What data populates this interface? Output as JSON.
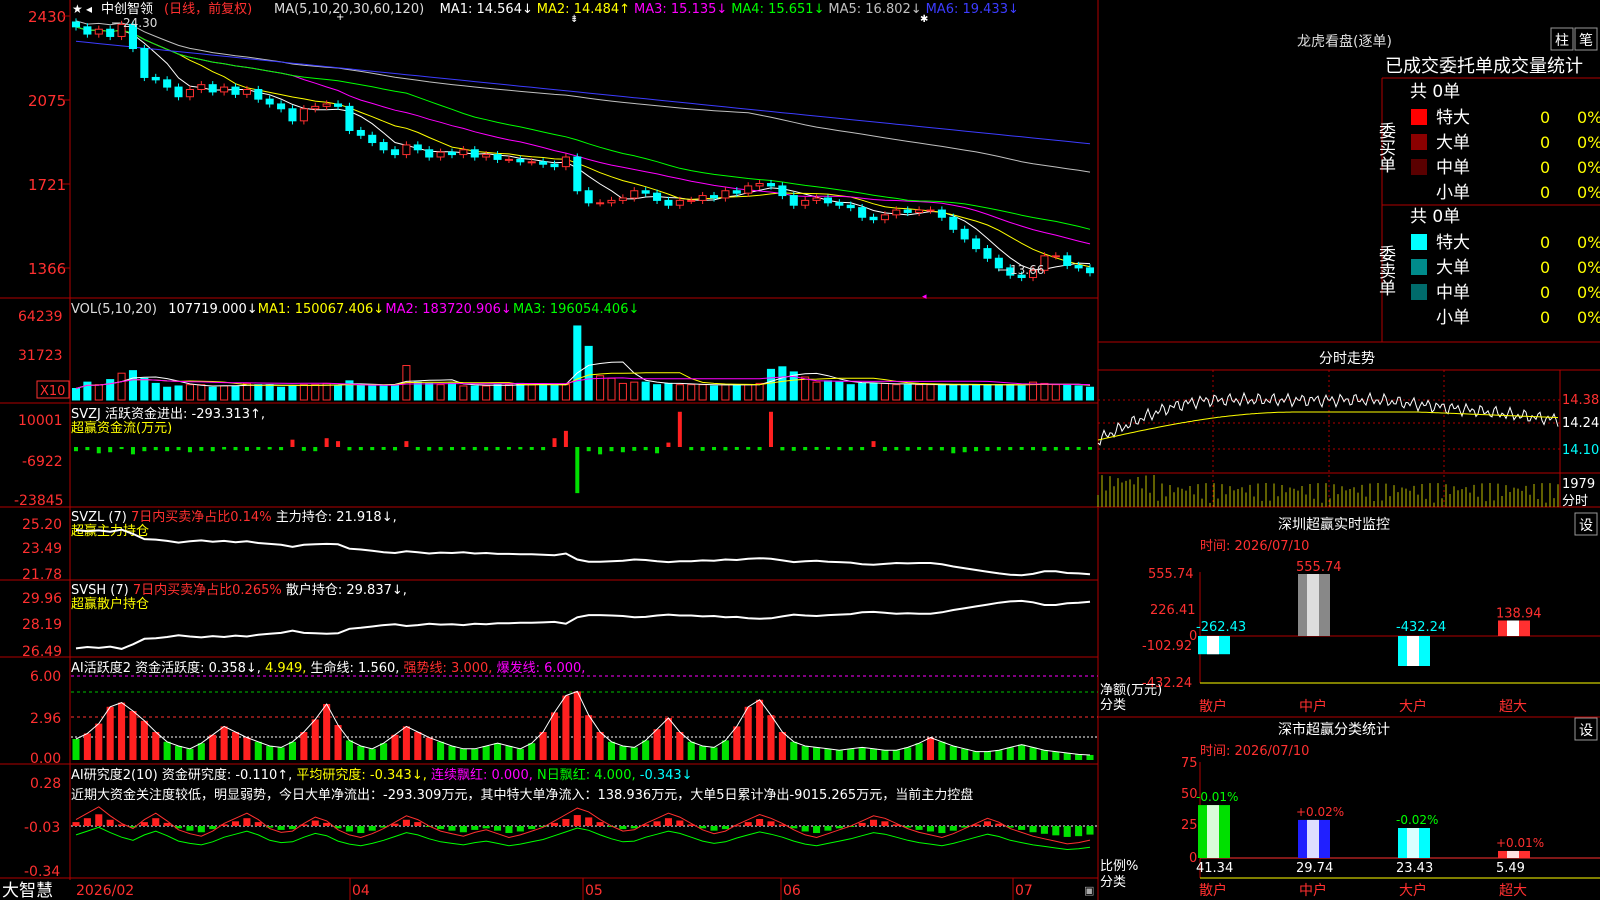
{
  "stock": {
    "name": "中创智领",
    "period": "(日线，前复权)",
    "high_label": "24.30",
    "low_label": "13.66"
  },
  "price_axis": {
    "ticks": [
      "2430",
      "2075",
      "1721",
      "1366"
    ]
  },
  "ma_legend": [
    {
      "label": "MA(5,10,20,30,60,120)",
      "color": "#dddddd"
    },
    {
      "label": "MA1: 14.564↓",
      "color": "#ffffff"
    },
    {
      "label": "MA2: 14.484↑",
      "color": "#ffff00"
    },
    {
      "label": "MA3: 15.135↓",
      "color": "#ff00ff"
    },
    {
      "label": "MA4: 15.651↓",
      "color": "#00ff00"
    },
    {
      "label": "MA5: 16.802↓",
      "color": "#c0c0c0"
    },
    {
      "label": "MA6: 19.433↓",
      "color": "#3c3cff"
    }
  ],
  "vol_legend": [
    {
      "label": "VOL(5,10,20)",
      "color": "#dddddd"
    },
    {
      "label": "107719.000↓",
      "color": "#ffffff"
    },
    {
      "label": "MA1: 150067.406↓",
      "color": "#ffff00"
    },
    {
      "label": "MA2: 183720.906↓",
      "color": "#ff00ff"
    },
    {
      "label": "MA3: 196054.406↓",
      "color": "#00ff00"
    }
  ],
  "vol_axis": {
    "ticks": [
      "64239",
      "31723"
    ],
    "unit": "X10"
  },
  "svzj": {
    "legend": "SVZJ  活跃资金进出: -293.313↑,",
    "sub": "超赢资金流(万元)",
    "ticks": [
      "10001",
      "-6922",
      "-23845"
    ]
  },
  "svzl": {
    "legend_a": "SVZL (7)",
    "legend_b": "7日内买卖净占比0.14%",
    "legend_c": "主力持仓: 21.918↓,",
    "sub": "超赢主力持仓",
    "ticks": [
      "25.20",
      "23.49",
      "21.78"
    ]
  },
  "svsh": {
    "legend_a": "SVSH (7)",
    "legend_b": "7日内买卖净占比0.265%",
    "legend_c": "散户持仓: 29.837↓,",
    "sub": "超赢散户持仓",
    "ticks": [
      "29.96",
      "28.19",
      "26.49"
    ]
  },
  "ai_active": {
    "legend_a": "AI活跃度2 资金活跃度: 0.358↓,",
    "legend_b": "4.949,",
    "legend_c": "生命线: 1.560,",
    "legend_d": "强势线: 3.000,",
    "legend_e": "爆发线: 6.000,",
    "ticks": [
      "6.00",
      "2.96",
      "0.00"
    ]
  },
  "ai_research": {
    "legend_a": "AI研究度2(10) 资金研究度: -0.110↑,",
    "legend_b": "平均研究度: -0.343↓,",
    "legend_c": "连续飘红: 0.000,",
    "legend_d": "N日飘红: 4.000,",
    "legend_e": "-0.343↓",
    "comment": "近期大资金关注度较低，明显弱势，今日大单净流出：-293.309万元，其中特大单净流入：138.936万元，大单5日累计净出-9015.265万元，当前主力控盘",
    "ticks": [
      "0.28",
      "-0.03",
      "-0.34"
    ]
  },
  "x_axis": {
    "brand": "大智慧",
    "labels": [
      "2026/02",
      "04",
      "05",
      "06",
      "07"
    ]
  },
  "lhb": {
    "title": "龙虎看盘(逐单)",
    "btn_zhu": "柱",
    "btn_bi": "笔",
    "subtitle": "已成交委托单成交量统计",
    "buy": {
      "side": "委买单",
      "total": "共 0单",
      "rows": [
        {
          "n": "特大",
          "v": "0",
          "p": "0%",
          "c": "#ff0000"
        },
        {
          "n": "大单",
          "v": "0",
          "p": "0%",
          "c": "#8b0000"
        },
        {
          "n": "中单",
          "v": "0",
          "p": "0%",
          "c": "#5a0000"
        },
        {
          "n": "小单",
          "v": "0",
          "p": "0%",
          "c": ""
        }
      ]
    },
    "sell": {
      "side": "委卖单",
      "total": "共 0单",
      "rows": [
        {
          "n": "特大",
          "v": "0",
          "p": "0%",
          "c": "#00ffff"
        },
        {
          "n": "大单",
          "v": "0",
          "p": "0%",
          "c": "#008b8b"
        },
        {
          "n": "中单",
          "v": "0",
          "p": "0%",
          "c": "#006b6b"
        },
        {
          "n": "小单",
          "v": "0",
          "p": "0%",
          "c": ""
        }
      ]
    }
  },
  "intraday": {
    "title": "分时走势",
    "ticks": [
      "14.38",
      "14.24",
      "14.10"
    ],
    "vol_label": "1979",
    "vol_unit": "分时"
  },
  "sz_monitor": {
    "title": "深圳超赢实时监控",
    "btn": "设",
    "time": "时间: 2026/07/10",
    "yticks": [
      "555.74",
      "226.41",
      "0",
      "-102.92",
      "-432.24"
    ],
    "ylabel": "净额(万元)",
    "xlabel": "分类",
    "cats": [
      "散户",
      "中户",
      "大户",
      "超大"
    ],
    "values": [
      -262.43,
      555.74,
      -432.24,
      138.94
    ],
    "labels": [
      "-262.43",
      "555.74",
      "-432.24",
      "138.94"
    ]
  },
  "sz_class": {
    "title": "深市超赢分类统计",
    "btn": "设",
    "time": "时间: 2026/07/10",
    "yticks": [
      "75",
      "50",
      "25",
      "0"
    ],
    "ylabel": "比例%",
    "xlabel": "分类",
    "cats": [
      "散户",
      "中户",
      "大户",
      "超大"
    ],
    "values": [
      41.34,
      29.74,
      23.43,
      5.49
    ],
    "labels": [
      "41.34",
      "29.74",
      "23.43",
      "5.49"
    ],
    "deltas": [
      "-0.01%",
      "+0.02%",
      "-0.02%",
      "+0.01%"
    ]
  },
  "chart_data": {
    "type": "line",
    "title": "中创智领 (日线，前复权)",
    "price_range": [
      13.2,
      24.4
    ],
    "close_series": [
      24.2,
      23.9,
      24.1,
      23.8,
      24.3,
      23.3,
      22.1,
      22.0,
      21.7,
      21.3,
      21.6,
      21.8,
      21.5,
      21.7,
      21.4,
      21.6,
      21.2,
      21.0,
      20.8,
      20.3,
      20.8,
      20.9,
      21.0,
      20.9,
      19.9,
      19.7,
      19.4,
      19.1,
      18.9,
      19.3,
      19.1,
      18.8,
      19.0,
      18.9,
      19.1,
      18.8,
      18.9,
      18.7,
      18.7,
      18.6,
      18.6,
      18.5,
      18.4,
      18.8,
      17.4,
      16.9,
      16.9,
      17.0,
      17.1,
      17.4,
      17.3,
      17.0,
      16.8,
      17.0,
      17.0,
      17.2,
      17.1,
      17.4,
      17.3,
      17.6,
      17.7,
      17.6,
      17.2,
      16.8,
      17.0,
      17.1,
      16.9,
      16.8,
      16.7,
      16.3,
      16.2,
      16.4,
      16.6,
      16.5,
      16.6,
      16.6,
      16.3,
      15.8,
      15.4,
      15.0,
      14.6,
      14.2,
      13.9,
      13.8,
      14.1,
      14.7,
      14.7,
      14.3,
      14.2,
      14.0
    ],
    "vol_series": [
      9000,
      14000,
      12000,
      16000,
      21000,
      23000,
      17000,
      13000,
      10000,
      11000,
      12000,
      12000,
      10000,
      11000,
      11000,
      13000,
      12000,
      12000,
      10000,
      11000,
      12000,
      12000,
      13000,
      11000,
      15000,
      12000,
      11000,
      11000,
      12000,
      27000,
      14000,
      13000,
      12000,
      13000,
      11000,
      11000,
      11000,
      12000,
      12000,
      13000,
      12000,
      12000,
      12000,
      12000,
      58000,
      42000,
      19000,
      17000,
      13000,
      14000,
      14000,
      12000,
      13000,
      12000,
      12000,
      12000,
      11000,
      12000,
      12000,
      12000,
      13000,
      24000,
      26000,
      22000,
      18000,
      14000,
      15000,
      14000,
      12000,
      13000,
      13000,
      13000,
      12000,
      12000,
      12000,
      12000,
      12000,
      12000,
      12000,
      12000,
      12000,
      12000,
      12000,
      11000,
      14000,
      13000,
      12000,
      12000,
      11000,
      10000
    ],
    "svzj_series": [
      -2000,
      -1500,
      -3000,
      -2500,
      -1000,
      -3500,
      -2000,
      -1500,
      -2000,
      -1500,
      -2500,
      -1800,
      -2000,
      -1200,
      -1500,
      -1800,
      -1400,
      -1200,
      -1500,
      2500,
      -1800,
      -2000,
      3000,
      2000,
      -1600,
      -1500,
      -1500,
      -1400,
      -1600,
      2000,
      -1500,
      -1700,
      -1600,
      -1500,
      -1400,
      -1500,
      -1600,
      -1500,
      -1300,
      -1200,
      -1400,
      -1500,
      3000,
      5500,
      -22000,
      -2000,
      -3500,
      -2000,
      -2500,
      -1800,
      -1500,
      -3000,
      1500,
      12000,
      -1500,
      -1800,
      -1500,
      -1600,
      -1400,
      -1300,
      -1500,
      12000,
      -1600,
      -1800,
      -1500,
      -1400,
      -1300,
      -1500,
      -1600,
      -1500,
      2000,
      -1800,
      -1500,
      -1700,
      -1400,
      -1500,
      -1600,
      -3000,
      -2500,
      -2000,
      -1800,
      -1600,
      -1500,
      -1400,
      -1500,
      -1800,
      -1600,
      -1500,
      -1400,
      -1300
    ],
    "active_series": [
      1.5,
      1.9,
      2.6,
      3.8,
      4.1,
      3.5,
      2.8,
      2.0,
      1.3,
      1.0,
      0.8,
      1.2,
      1.8,
      2.4,
      2.0,
      1.6,
      1.3,
      1.0,
      0.9,
      1.3,
      2.0,
      2.9,
      4.0,
      2.5,
      1.4,
      1.0,
      0.8,
      1.2,
      1.8,
      2.4,
      2.0,
      1.6,
      1.3,
      1.0,
      0.8,
      0.8,
      1.0,
      1.2,
      1.0,
      0.8,
      1.2,
      2.0,
      3.4,
      4.6,
      4.9,
      3.2,
      2.0,
      1.3,
      1.0,
      0.9,
      1.4,
      2.2,
      3.0,
      2.0,
      1.3,
      1.0,
      0.9,
      1.4,
      2.4,
      3.8,
      4.3,
      3.2,
      2.0,
      1.3,
      1.0,
      0.9,
      0.8,
      0.7,
      0.8,
      0.9,
      0.8,
      0.7,
      0.7,
      0.9,
      1.2,
      1.6,
      1.3,
      1.0,
      0.8,
      0.6,
      0.6,
      0.7,
      0.9,
      1.1,
      0.9,
      0.7,
      0.6,
      0.5,
      0.4,
      0.36
    ],
    "research_series": [
      0.05,
      0.1,
      0.15,
      0.08,
      0.02,
      -0.02,
      0.05,
      0.1,
      0.04,
      -0.03,
      -0.06,
      -0.08,
      -0.04,
      0.02,
      0.06,
      0.1,
      0.05,
      -0.02,
      -0.05,
      -0.04,
      0.02,
      0.07,
      0.04,
      -0.03,
      -0.07,
      -0.09,
      -0.06,
      -0.02,
      0.03,
      0.08,
      0.05,
      0.0,
      -0.04,
      -0.06,
      -0.08,
      -0.05,
      -0.03,
      -0.06,
      -0.09,
      -0.07,
      -0.04,
      -0.01,
      0.04,
      0.09,
      0.14,
      0.11,
      0.05,
      0.0,
      -0.04,
      -0.03,
      0.02,
      0.06,
      0.1,
      0.07,
      0.02,
      -0.03,
      -0.06,
      -0.04,
      0.01,
      0.05,
      0.09,
      0.06,
      0.02,
      -0.03,
      -0.07,
      -0.09,
      -0.06,
      -0.03,
      0.0,
      0.04,
      0.08,
      0.06,
      0.02,
      -0.02,
      -0.05,
      -0.07,
      -0.09,
      -0.06,
      -0.02,
      0.02,
      0.06,
      0.03,
      -0.02,
      -0.05,
      -0.08,
      -0.1,
      -0.12,
      -0.14,
      -0.13,
      -0.11
    ]
  }
}
